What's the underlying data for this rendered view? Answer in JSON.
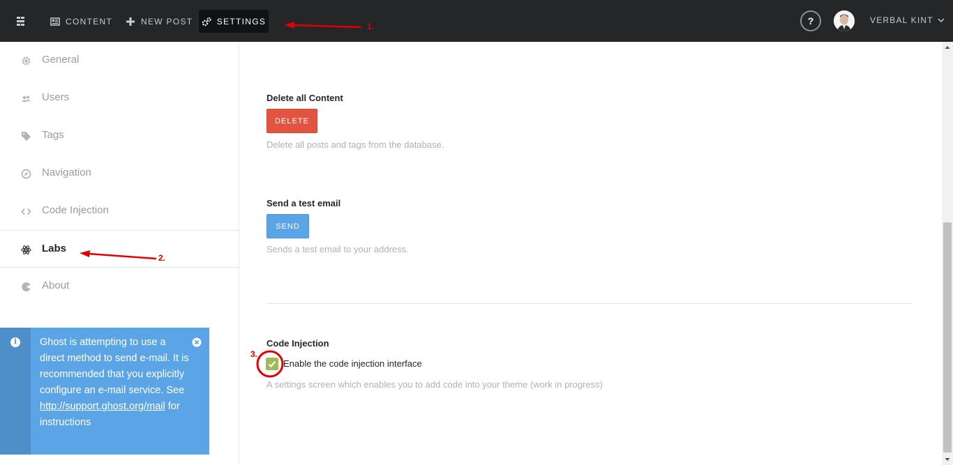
{
  "topbar": {
    "nav": [
      {
        "label": "CONTENT",
        "icon": "content-icon"
      },
      {
        "label": "NEW POST",
        "icon": "plus-icon"
      },
      {
        "label": "SETTINGS",
        "icon": "gear-icon",
        "active": true
      }
    ],
    "help_label": "?",
    "user_name": "VERBAL KINT"
  },
  "sidebar": {
    "items": [
      {
        "label": "General",
        "icon": "gear-icon"
      },
      {
        "label": "Users",
        "icon": "users-icon"
      },
      {
        "label": "Tags",
        "icon": "tag-icon"
      },
      {
        "label": "Navigation",
        "icon": "compass-icon"
      },
      {
        "label": "Code Injection",
        "icon": "code-icon"
      },
      {
        "label": "Labs",
        "icon": "atom-icon",
        "active": true
      },
      {
        "label": "About",
        "icon": "pacman-icon"
      }
    ]
  },
  "notification": {
    "text_before": "Ghost is attempting to use a direct method to send e-mail. It is recommended that you explicitly configure an e-mail service. See ",
    "link": "http://support.ghost.org/mail",
    "text_after": " for instructions",
    "color": "#5ba4e5"
  },
  "main": {
    "delete": {
      "title": "Delete all Content",
      "button": "DELETE",
      "help": "Delete all posts and tags from the database."
    },
    "email": {
      "title": "Send a test email",
      "button": "SEND",
      "help": "Sends a test email to your address."
    },
    "code_injection": {
      "title": "Code Injection",
      "checkbox_label": "Enable the code injection interface",
      "checked": true,
      "help": "A settings screen which enables you to add code into your theme (work in progress)"
    }
  },
  "annotations": [
    "1.",
    "2.",
    "3."
  ],
  "colors": {
    "topbar": "#242628",
    "delete": "#e25440",
    "send": "#5ba4e5",
    "checkbox": "#9fbb58",
    "annotation": "#e00000"
  }
}
